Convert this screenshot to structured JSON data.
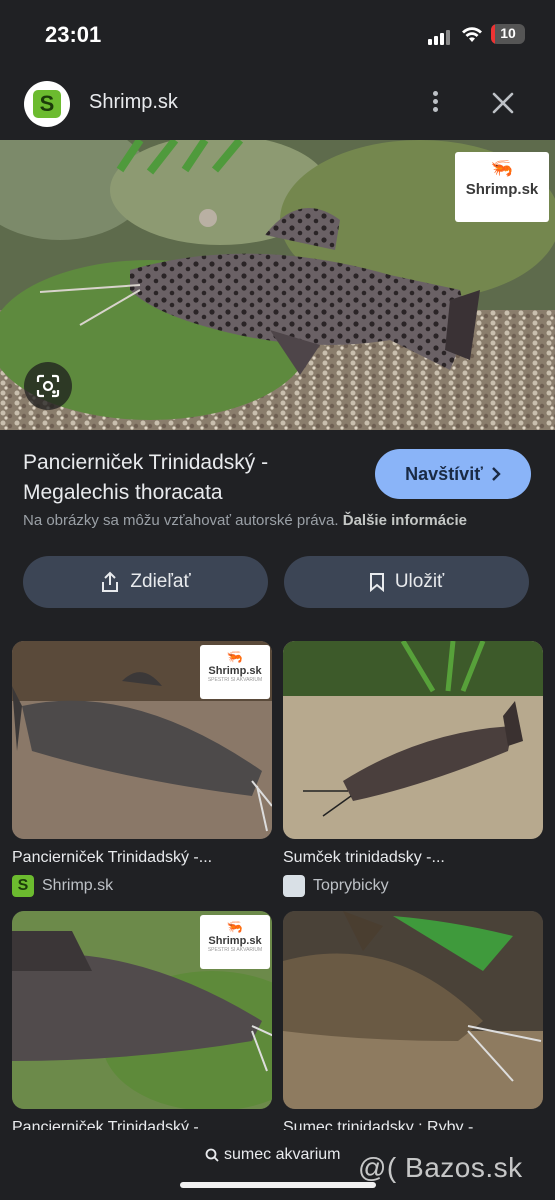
{
  "status_bar": {
    "time": "23:01",
    "battery": "10"
  },
  "header": {
    "site_name": "Shrimp.sk",
    "logo_letter": "S"
  },
  "image": {
    "watermark": "Shrimp.sk"
  },
  "result": {
    "title": "Pancierniček Trinidadský - Megalechis thoracata",
    "visit_label": "Navštíviť",
    "notice": "Na obrázky sa môžu vzťahovať autorské práva.",
    "notice_link": "Ďalšie informácie"
  },
  "actions": {
    "share_label": "Zdieľať",
    "save_label": "Uložiť"
  },
  "related": [
    {
      "title": "Pancierniček Trinidadský -...",
      "source": "Shrimp.sk",
      "favicon": "S",
      "watermark": "Shrimp.sk",
      "watermark_sub": "SPESTRI SI AKVARIUM"
    },
    {
      "title": "Sumček trinidadsky -...",
      "source": "Toprybicky"
    },
    {
      "title": "Pancierniček Trinidadský -...",
      "watermark": "Shrimp.sk",
      "watermark_sub": "SPESTRI SI AKVARIUM"
    },
    {
      "title": "Sumec trinidadsky : Ryby -..."
    }
  ],
  "bottom": {
    "search_query": "sumec akvarium",
    "overlay_watermark": "@( Bazos.sk"
  },
  "colors": {
    "accent": "#8ab4f8",
    "background": "#202124",
    "button": "#3c4555",
    "brand_green": "#6cbb2f"
  }
}
